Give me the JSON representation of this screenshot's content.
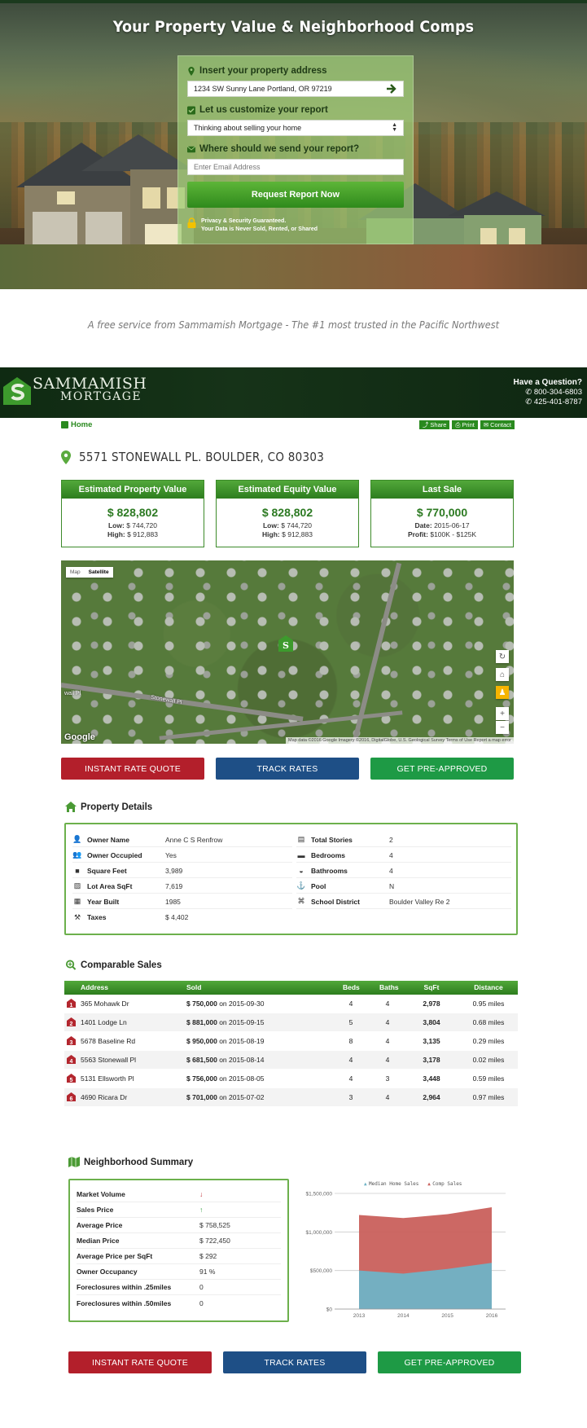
{
  "hero": {
    "title": "Your Property Value & Neighborhood Comps",
    "address_label": "Insert your property address",
    "address_value": "1234 SW Sunny Lane  Portland, OR 97219",
    "customize_label": "Let us customize your report",
    "customize_value": "Thinking about selling your home",
    "send_label": "Where should we send your report?",
    "email_placeholder": "Enter Email Address",
    "request_button": "Request Report Now",
    "privacy_line1": "Privacy & Security Guaranteed.",
    "privacy_line2": "Your Data is Never Sold, Rented, or Shared"
  },
  "tagline": "A free service from Sammamish Mortgage - The #1 most trusted in the Pacific Northwest",
  "brand": {
    "name_line1": "SAMMAMISH",
    "name_line2": "MORTGAGE",
    "question": "Have a Question?",
    "phone1": "800-304-6803",
    "phone2": "425-401-8787"
  },
  "nav": {
    "home": "Home",
    "share": "Share",
    "print": "Print",
    "contact": "Contact"
  },
  "property_address": "5571 STONEWALL PL. BOULDER, CO 80303",
  "cards": [
    {
      "title": "Estimated Property Value",
      "value": "$ 828,802",
      "l1k": "Low:",
      "l1v": "$ 744,720",
      "l2k": "High:",
      "l2v": "$ 912,883"
    },
    {
      "title": "Estimated Equity Value",
      "value": "$ 828,802",
      "l1k": "Low:",
      "l1v": "$ 744,720",
      "l2k": "High:",
      "l2v": "$ 912,883"
    },
    {
      "title": "Last Sale",
      "value": "$ 770,000",
      "l1k": "Date:",
      "l1v": "2015-06-17",
      "l2k": "Profit:",
      "l2v": "$100K - $125K"
    }
  ],
  "map": {
    "tab_map": "Map",
    "tab_satellite": "Satellite",
    "google": "Google",
    "attribution": "Map data ©2016 Google Imagery ©2016, DigitalGlobe, U.S. Geological Survey   Terms of Use   Report a map error",
    "label_stonewall": "Stonewall Pl",
    "label_wall": "wall Pl"
  },
  "cta": {
    "rate_quote": "INSTANT RATE QUOTE",
    "track_rates": "TRACK RATES",
    "pre_approved": "GET PRE-APPROVED"
  },
  "details": {
    "title": "Property Details",
    "left": [
      {
        "k": "Owner Name",
        "v": "Anne C S Renfrow"
      },
      {
        "k": "Owner Occupied",
        "v": "Yes"
      },
      {
        "k": "Square Feet",
        "v": "3,989"
      },
      {
        "k": "Lot Area SqFt",
        "v": "7,619"
      },
      {
        "k": "Year Built",
        "v": "1985"
      },
      {
        "k": "Taxes",
        "v": "$ 4,402"
      }
    ],
    "right": [
      {
        "k": "Total Stories",
        "v": "2"
      },
      {
        "k": "Bedrooms",
        "v": "4"
      },
      {
        "k": "Bathrooms",
        "v": "4"
      },
      {
        "k": "Pool",
        "v": "N"
      },
      {
        "k": "School District",
        "v": "Boulder Valley Re 2"
      }
    ]
  },
  "comps": {
    "title": "Comparable Sales",
    "headers": {
      "address": "Address",
      "sold": "Sold",
      "beds": "Beds",
      "baths": "Baths",
      "sqft": "SqFt",
      "distance": "Distance"
    },
    "rows": [
      {
        "n": "1",
        "address": "365 Mohawk Dr",
        "price": "$ 750,000",
        "on": "on 2015-09-30",
        "beds": "4",
        "baths": "4",
        "sqft": "2,978",
        "distance": "0.95 miles"
      },
      {
        "n": "2",
        "address": "1401 Lodge Ln",
        "price": "$ 881,000",
        "on": "on 2015-09-15",
        "beds": "5",
        "baths": "4",
        "sqft": "3,804",
        "distance": "0.68 miles"
      },
      {
        "n": "3",
        "address": "5678 Baseline Rd",
        "price": "$ 950,000",
        "on": "on 2015-08-19",
        "beds": "8",
        "baths": "4",
        "sqft": "3,135",
        "distance": "0.29 miles"
      },
      {
        "n": "4",
        "address": "5563 Stonewall Pl",
        "price": "$ 681,500",
        "on": "on 2015-08-14",
        "beds": "4",
        "baths": "4",
        "sqft": "3,178",
        "distance": "0.02 miles"
      },
      {
        "n": "5",
        "address": "5131 Ellsworth Pl",
        "price": "$ 756,000",
        "on": "on 2015-08-05",
        "beds": "4",
        "baths": "3",
        "sqft": "3,448",
        "distance": "0.59 miles"
      },
      {
        "n": "6",
        "address": "4690 Ricara Dr",
        "price": "$ 701,000",
        "on": "on 2015-07-02",
        "beds": "3",
        "baths": "4",
        "sqft": "2,964",
        "distance": "0.97 miles"
      }
    ]
  },
  "neighborhood": {
    "title": "Neighborhood Summary",
    "rows": [
      {
        "k": "Market Volume",
        "v": "",
        "trend": "down"
      },
      {
        "k": "Sales Price",
        "v": "",
        "trend": "up"
      },
      {
        "k": "Average Price",
        "v": "$ 758,525"
      },
      {
        "k": "Median Price",
        "v": "$ 722,450"
      },
      {
        "k": "Average Price per SqFt",
        "v": "$ 292"
      },
      {
        "k": "Owner Occupancy",
        "v": "91 %"
      },
      {
        "k": "Foreclosures within .25miles",
        "v": "0"
      },
      {
        "k": "Foreclosures within .50miles",
        "v": "0"
      }
    ]
  },
  "chart_data": {
    "type": "area",
    "x": [
      2013,
      2014,
      2015,
      2016
    ],
    "series": [
      {
        "name": "Median Home Sales",
        "values": [
          500000,
          460000,
          520000,
          600000
        ],
        "color": "#6fb3c6"
      },
      {
        "name": "Comp Sales",
        "values": [
          1220000,
          1180000,
          1230000,
          1320000
        ],
        "color": "#c9605c"
      }
    ],
    "yticks": [
      "$0",
      "$500,000",
      "$1,000,000",
      "$1,500,000"
    ],
    "ylim": [
      0,
      1500000
    ],
    "legend_position": "top",
    "grid": true
  }
}
